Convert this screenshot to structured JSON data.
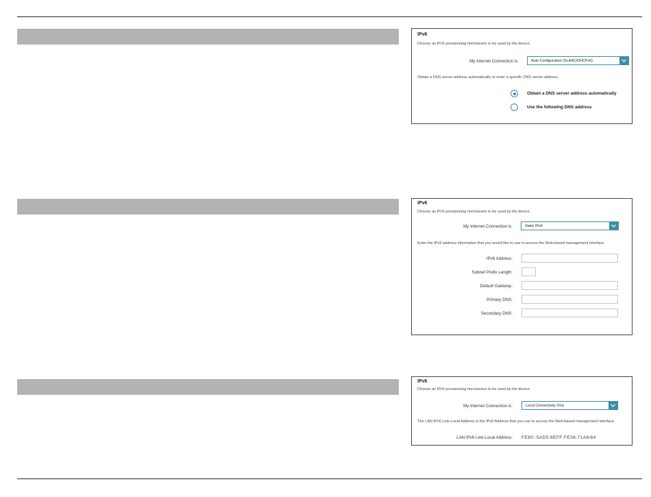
{
  "panels": [
    {
      "title": "IPv6",
      "intro": "Choose an IPv6 provisioning mechanism to be used by the device.",
      "connection_label": "My Internet Connection is:",
      "connection_value": "Auto Configuration (SLAAC/DHCPv6)",
      "dns_text": "Obtain a DNS server address automatically or enter a specific DNS server address.",
      "radio_auto": "Obtain a DNS server address automatically",
      "radio_manual": "Use the following DNS address"
    },
    {
      "title": "IPv6",
      "intro": "Choose an IPv6 provisioning mechanism to be used by the device.",
      "connection_label": "My Internet Connection is:",
      "connection_value": "Static IPv6",
      "info_text": "Enter the IPv6 address information that you would like to use to access the Web-based management interface.",
      "fields": [
        {
          "label": "IPv6 Address:",
          "value": ""
        },
        {
          "label": "Subnet Prefix Length:",
          "value": ""
        },
        {
          "label": "Default Gateway:",
          "value": ""
        },
        {
          "label": "Primary DNS:",
          "value": ""
        },
        {
          "label": "Secondary DNS:",
          "value": ""
        }
      ]
    },
    {
      "title": "IPv6",
      "intro": "Choose an IPv6 provisioning mechanism to be used by the device.",
      "connection_label": "My Internet Connection is:",
      "connection_value": "Local Connectivity Only",
      "info_text": "The LAN IPv6 Link-Local Address is the IPv6 Address that you use to access the Web-based management interface.",
      "link_local_label": "LAN IPv6 Link-Local Address:",
      "link_local_value": "FE80::5AD5:6EFF:FE36:71A8/64"
    }
  ],
  "colors": {
    "accent": "#3b8ea5",
    "section_bar": "#b3b3b3",
    "panel_border": "#444444"
  },
  "icons": [
    "chevron-down-icon",
    "radio-selected-icon",
    "radio-unselected-icon"
  ]
}
